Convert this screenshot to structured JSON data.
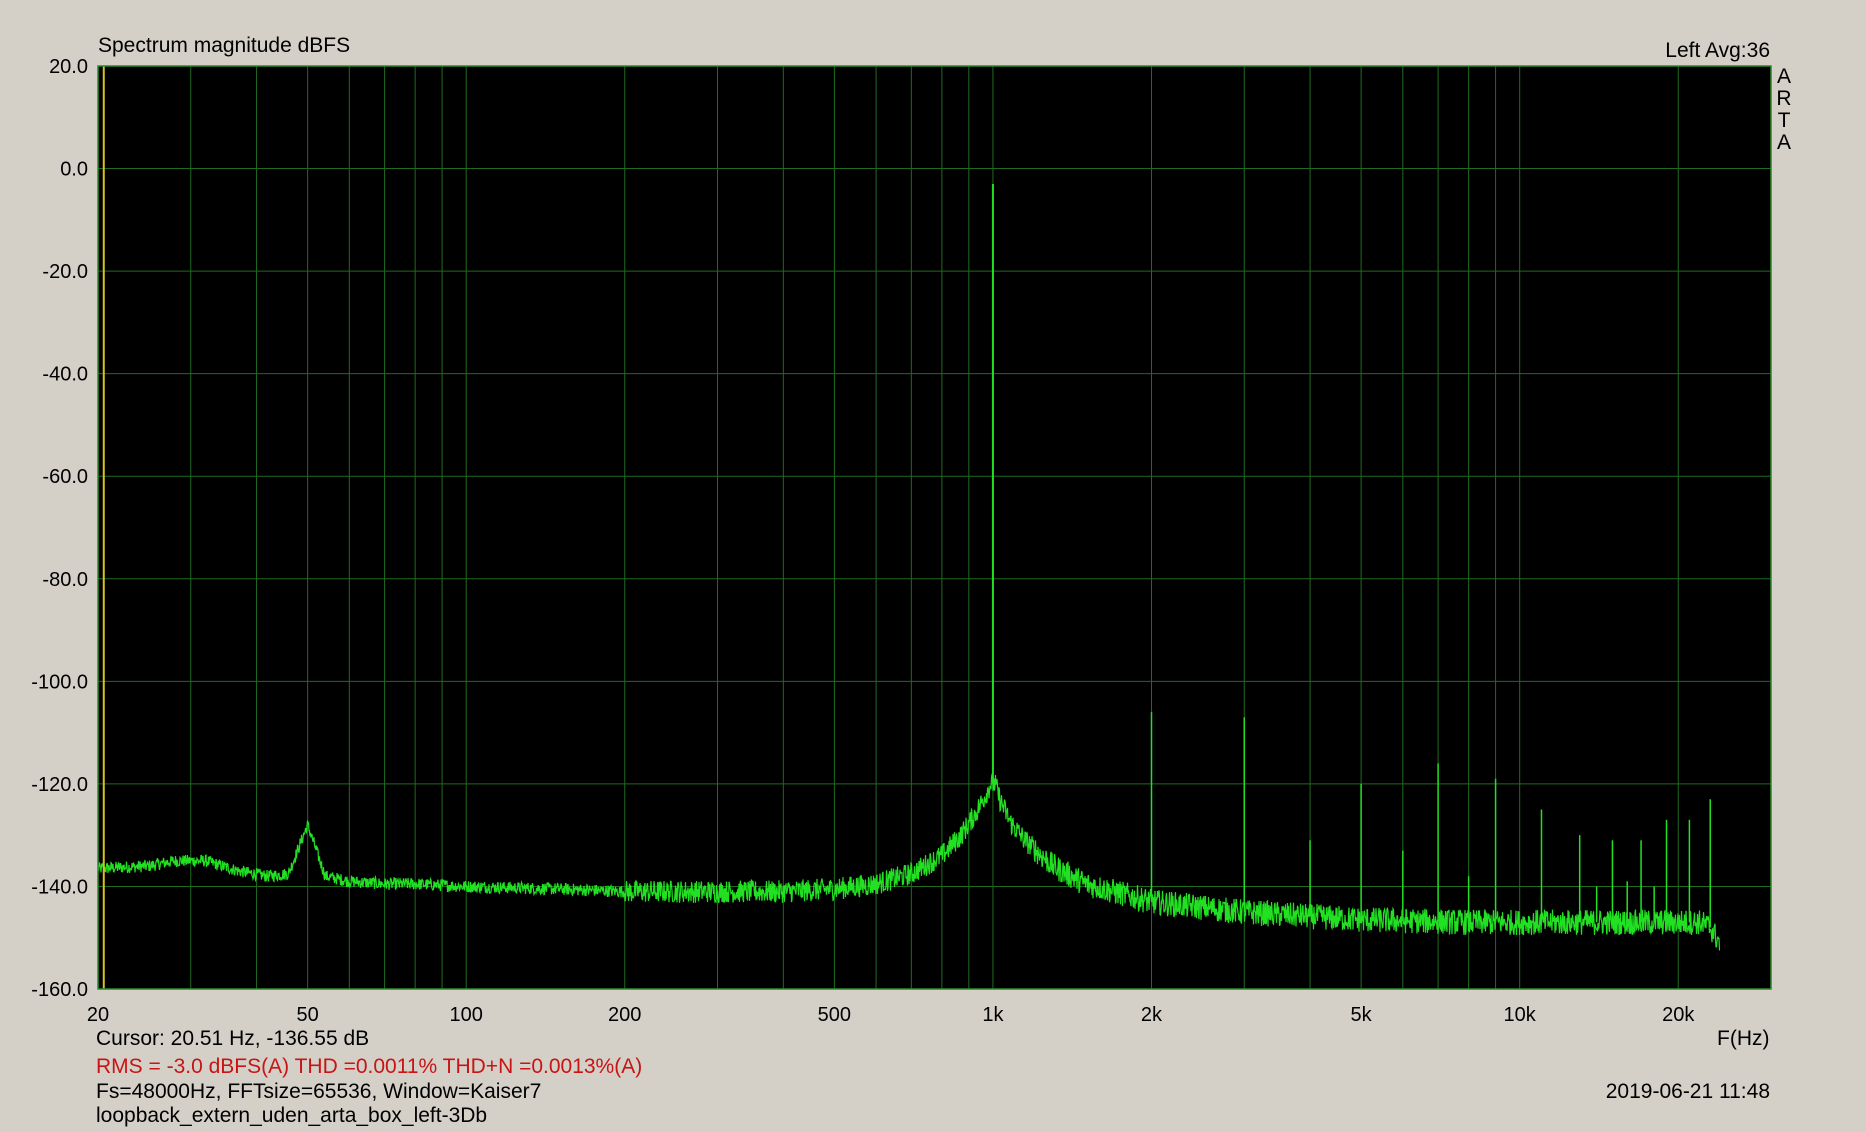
{
  "chart_data": {
    "type": "line",
    "title": "Spectrum magnitude dBFS",
    "channel_label": "Left  Avg:36",
    "brand": [
      "A",
      "R",
      "T",
      "A"
    ],
    "xlabel": "F(Hz)",
    "x_scale": "log",
    "xlim": [
      20,
      30000
    ],
    "ylim": [
      -160,
      20
    ],
    "grid": true,
    "y_ticks": [
      20,
      0,
      -20,
      -40,
      -60,
      -80,
      -100,
      -120,
      -140,
      -160
    ],
    "y_tick_labels": [
      "20.0",
      "0.0",
      "-20.0",
      "-40.0",
      "-60.0",
      "-80.0",
      "-100.0",
      "-120.0",
      "-140.0",
      "-160.0"
    ],
    "x_ticks": [
      20,
      50,
      100,
      200,
      500,
      1000,
      2000,
      5000,
      10000,
      20000
    ],
    "x_tick_labels": [
      "20",
      "50",
      "100",
      "200",
      "500",
      "1k",
      "2k",
      "5k",
      "10k",
      "20k"
    ],
    "x_minor_grid": [
      30,
      40,
      60,
      70,
      80,
      90,
      300,
      400,
      600,
      700,
      800,
      900,
      3000,
      4000,
      6000,
      7000,
      8000,
      9000
    ],
    "cursor_hz": 20.51,
    "noise_floor": {
      "x": [
        20,
        25,
        28,
        32,
        37,
        42,
        46,
        50,
        54,
        60,
        70,
        80,
        100,
        150,
        200,
        300,
        400,
        500,
        600,
        700,
        800,
        870,
        930,
        970,
        990,
        1010,
        1030,
        1080,
        1150,
        1300,
        1500,
        2000,
        3000,
        5000,
        8000,
        12000,
        18000,
        22000,
        23000,
        24000
      ],
      "y": [
        -136.5,
        -136,
        -135,
        -135,
        -137,
        -138,
        -137.5,
        -128,
        -138,
        -139,
        -139.5,
        -139.5,
        -140,
        -140.5,
        -141,
        -141,
        -141,
        -140.5,
        -139.5,
        -137.5,
        -134,
        -130,
        -125.5,
        -122,
        -120,
        -120,
        -123,
        -127.5,
        -131,
        -136,
        -139.5,
        -143,
        -145,
        -146.5,
        -147,
        -147,
        -147,
        -147,
        -148,
        -151
      ]
    },
    "spikes": [
      {
        "x": 1000,
        "y": -3.0
      },
      {
        "x": 2000,
        "y": -106
      },
      {
        "x": 3000,
        "y": -107
      },
      {
        "x": 4000,
        "y": -131
      },
      {
        "x": 5000,
        "y": -120
      },
      {
        "x": 6000,
        "y": -133
      },
      {
        "x": 7000,
        "y": -116
      },
      {
        "x": 8000,
        "y": -138
      },
      {
        "x": 9000,
        "y": -119
      },
      {
        "x": 11000,
        "y": -125
      },
      {
        "x": 13000,
        "y": -130
      },
      {
        "x": 14000,
        "y": -140
      },
      {
        "x": 15000,
        "y": -131
      },
      {
        "x": 16000,
        "y": -139
      },
      {
        "x": 17000,
        "y": -131
      },
      {
        "x": 18000,
        "y": -140
      },
      {
        "x": 19000,
        "y": -127
      },
      {
        "x": 21000,
        "y": -127
      },
      {
        "x": 23000,
        "y": -123
      }
    ],
    "noise_seed_band": 2.5,
    "colors": {
      "plot_bg": "#000000",
      "grid": "#1f6b1f",
      "trace": "#22e122",
      "cursor": "#d7c21e",
      "frame": "#2a8a2a"
    }
  },
  "footer": {
    "cursor": "Cursor: 20.51 Hz, -136.55 dB",
    "metrics": "RMS =   -3.0 dBFS(A)  THD =0.0011%  THD+N =0.0013%(A)",
    "settings": "Fs=48000Hz, FFTsize=65536, Window=Kaiser7",
    "filename": "loopback_extern_uden_arta_box_left-3Db",
    "datetime": "2019-06-21  11:48"
  }
}
